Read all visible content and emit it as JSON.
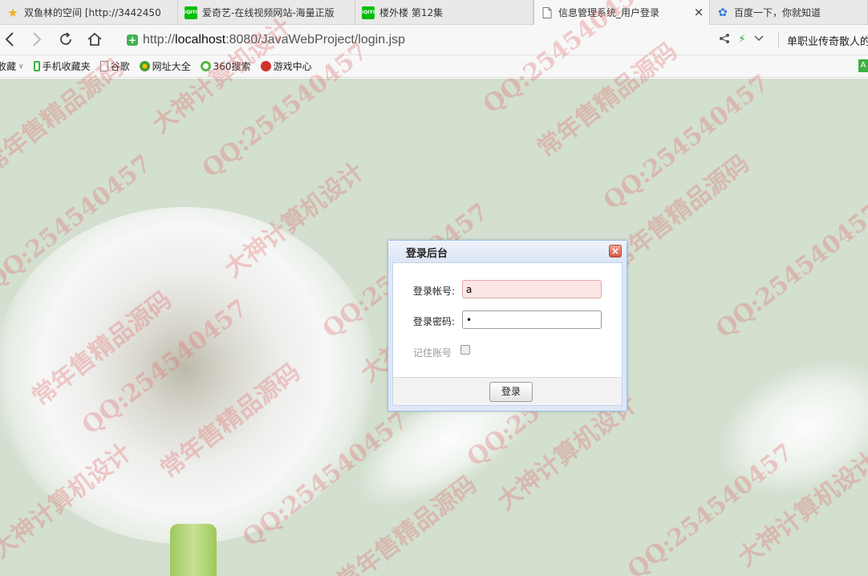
{
  "tabs": [
    {
      "label": "双鱼林的空间 [http://3442450",
      "icon": "star-icon",
      "icon_glyph": "★",
      "icon_color": "#f2b01e"
    },
    {
      "label": "爱奇艺-在线视频网站-海量正版",
      "icon": "iqiyi-icon",
      "icon_glyph": "iQIYI",
      "icon_color": "#00be06"
    },
    {
      "label": "楼外楼 第12集",
      "icon": "iqiyi-icon",
      "icon_glyph": "iQIYI",
      "icon_color": "#00be06"
    },
    {
      "label": "信息管理系统_用户登录",
      "icon": "page-icon",
      "icon_glyph": "",
      "icon_color": "#ffffff"
    },
    {
      "label": "百度一下，你就知道",
      "icon": "baidu-paw-icon",
      "icon_glyph": "✿",
      "icon_color": "#2f7be5"
    }
  ],
  "address": {
    "url_prefix": "http://",
    "url_host": "localhost",
    "url_rest": ":8080/JavaWebProject/login.jsp",
    "right_text": "单职业传奇散人的"
  },
  "bookmarks": [
    {
      "label": "收藏",
      "icon": "favorites-icon",
      "color": "#f7f7f7"
    },
    {
      "label": "手机收藏夹",
      "icon": "mobile-icon",
      "color": "#3cb043"
    },
    {
      "label": "谷歌",
      "icon": "page-icon",
      "color": "#ffffff"
    },
    {
      "label": "网址大全",
      "icon": "url-directory-icon",
      "color": "#4b9e2e"
    },
    {
      "label": "360搜索",
      "icon": "360-search-icon",
      "color": "#56b847"
    },
    {
      "label": "游戏中心",
      "icon": "game-center-icon",
      "color": "#d0312d"
    }
  ],
  "dialog": {
    "title": "登录后台",
    "close_glyph": "×",
    "account_label": "登录帐号:",
    "account_value": "a",
    "password_label": "登录密码:",
    "password_value": "a",
    "remember_label": "记住账号",
    "login_button": "登录"
  },
  "watermarks": [
    "常年售精品源码",
    "QQ:254540457",
    "大神计算机设计"
  ],
  "colors": {
    "page_background": "#d3dfcf",
    "dialog_border": "#99bbe8",
    "error_field_background": "#fde6e6"
  }
}
